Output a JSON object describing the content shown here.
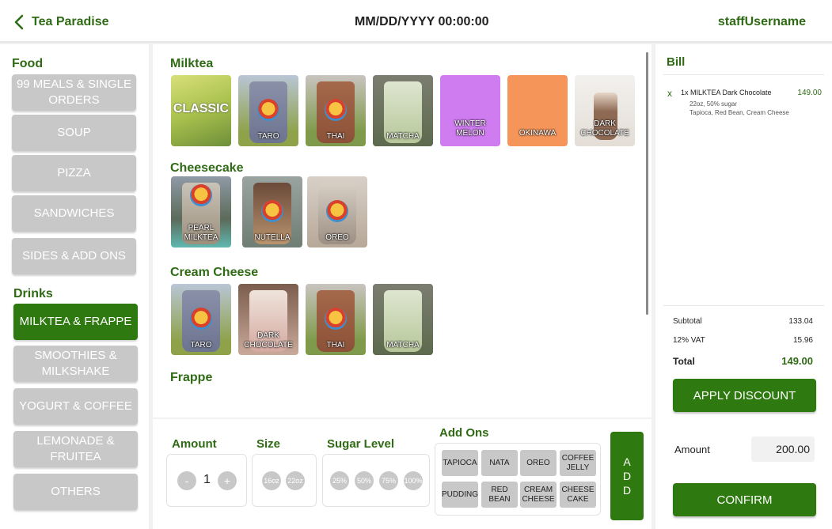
{
  "header": {
    "back_icon": "chevron-left-icon",
    "app_title": "Tea Paradise",
    "datetime": "MM/DD/YYYY 00:00:00",
    "username": "staffUsername"
  },
  "sidebar": {
    "food_label": "Food",
    "food_items": [
      "99 MEALS & SINGLE ORDERS",
      "SOUP",
      "PIZZA",
      "SANDWICHES",
      "SIDES & ADD ONS"
    ],
    "drinks_label": "Drinks",
    "drink_items": [
      "MILKTEA & FRAPPE",
      "SMOOTHIES & MILKSHAKE",
      "YOGURT & COFFEE",
      "LEMONADE & FRUITEA",
      "OTHERS"
    ],
    "active_item": "MILKTEA & FRAPPE"
  },
  "menu": {
    "sections": [
      {
        "title": "Milktea",
        "items": [
          "CLASSIC",
          "TARO",
          "THAI",
          "MATCHA",
          "WINTER MELON",
          "OKINAWA",
          "DARK CHOCOLATE"
        ]
      },
      {
        "title": "Cheesecake",
        "items": [
          "PEARL MILKTEA",
          "NUTELLA",
          "OREO"
        ]
      },
      {
        "title": "Cream Cheese",
        "items": [
          "TARO",
          "DARK CHOCOLATE",
          "THAI",
          "MATCHA"
        ]
      },
      {
        "title": "Frappe",
        "items": []
      }
    ]
  },
  "options": {
    "amount_label": "Amount",
    "minus": "-",
    "quantity": "1",
    "plus": "+",
    "size_label": "Size",
    "sizes": [
      "16oz",
      "22oz"
    ],
    "sugar_label": "Sugar Level",
    "sugar_levels": [
      "25%",
      "50%",
      "75%",
      "100%"
    ],
    "addons_label": "Add Ons",
    "addons": [
      "TAPIOCA",
      "NATA",
      "OREO",
      "COFFEE JELLY",
      "PUDDING",
      "RED BEAN",
      "CREAM CHEESE",
      "CHEESE CAKE"
    ],
    "add_letters": [
      "A",
      "D",
      "D"
    ]
  },
  "bill": {
    "title": "Bill",
    "items": [
      {
        "remove": "x",
        "name": "1x MILKTEA Dark Chocolate",
        "price": "149.00",
        "details": "22oz, 50% sugar",
        "addons": "Tapioca, Red Bean, Cream Cheese"
      }
    ],
    "subtotal_label": "Subtotal",
    "subtotal": "133.04",
    "vat_label": "12% VAT",
    "vat": "15.96",
    "total_label": "Total",
    "total": "149.00",
    "discount_button": "APPLY DISCOUNT",
    "amount_label": "Amount",
    "amount_value": "200.00",
    "confirm_button": "CONFIRM"
  },
  "colors": {
    "accent_green": "#2f7a10",
    "label_green": "#2f6b14",
    "inactive_gray": "#c8c8c8"
  }
}
